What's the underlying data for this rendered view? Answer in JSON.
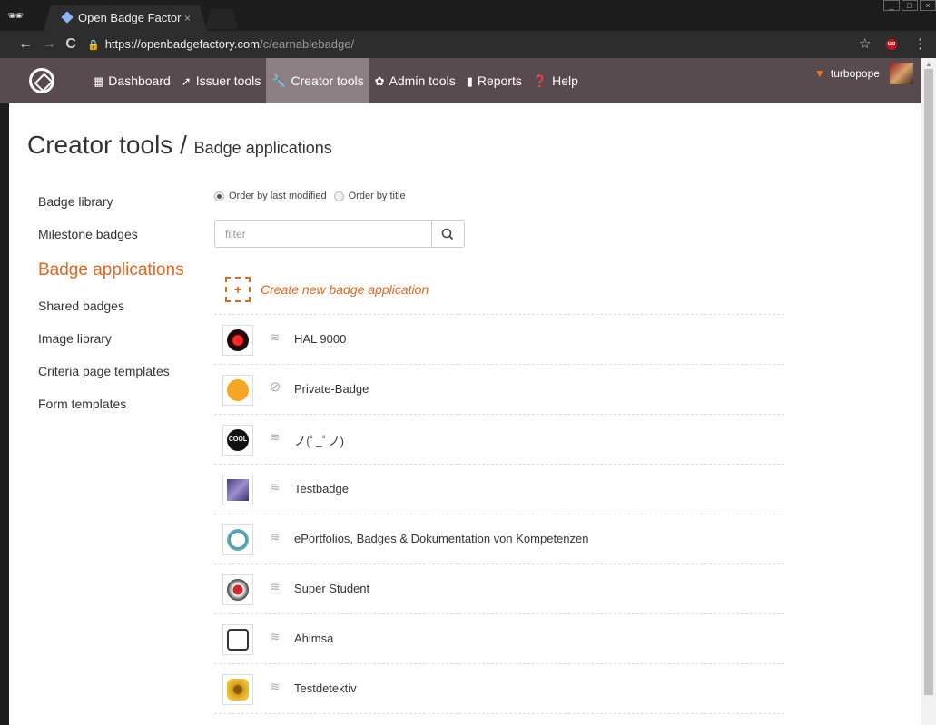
{
  "browser": {
    "tab_title": "Open Badge Factor",
    "tab_close": "×",
    "url_host": "https://openbadgefactory.com",
    "url_path": "/c/earnablebadge/",
    "incognito_glyph": "🕶",
    "star_glyph": "☆",
    "ublock_label": "uo",
    "kebab_glyph": "⋮",
    "back_glyph": "←",
    "forward_glyph": "→",
    "reload_glyph": "C"
  },
  "header": {
    "menu": [
      {
        "label": "Dashboard",
        "icon": "▦"
      },
      {
        "label": "Issuer tools",
        "icon": "➚"
      },
      {
        "label": "Creator tools",
        "icon": "🔧"
      },
      {
        "label": "Admin tools",
        "icon": "✿"
      },
      {
        "label": "Reports",
        "icon": "▮"
      },
      {
        "label": "Help",
        "icon": "❓"
      }
    ],
    "username": "turbopope",
    "accent_color": "#e3661f"
  },
  "page": {
    "title": "Creator tools /",
    "subtitle": "Badge applications"
  },
  "sidebar": {
    "items": [
      {
        "label": "Badge library"
      },
      {
        "label": "Milestone badges"
      },
      {
        "label": "Badge applications"
      },
      {
        "label": "Shared badges"
      },
      {
        "label": "Image library"
      },
      {
        "label": "Criteria page templates"
      },
      {
        "label": "Form templates"
      }
    ]
  },
  "order": {
    "last_modified": "Order by last modified",
    "by_title": "Order by title"
  },
  "filter": {
    "placeholder": "filter",
    "search_glyph": "🔍"
  },
  "create_label": "Create new badge application",
  "create_glyph": "+",
  "badges": [
    {
      "title": "HAL 9000",
      "visibility": "signal",
      "art": "#c00000"
    },
    {
      "title": "Private-Badge",
      "visibility": "private",
      "art": "#f5a623"
    },
    {
      "title": "ノ(ﾟ_ﾟノ)",
      "visibility": "signal",
      "art": "#111111"
    },
    {
      "title": "Testbadge",
      "visibility": "signal",
      "art": "#6b5a9e"
    },
    {
      "title": "ePortfolios, Badges & Dokumentation von Kompetenzen",
      "visibility": "signal",
      "art": "#3a8fd1"
    },
    {
      "title": "Super Student",
      "visibility": "signal",
      "art": "#cc2a2a"
    },
    {
      "title": "Ahimsa",
      "visibility": "signal",
      "art": "#555555"
    },
    {
      "title": "Testdetektiv",
      "visibility": "signal",
      "art": "#d4a017"
    }
  ]
}
